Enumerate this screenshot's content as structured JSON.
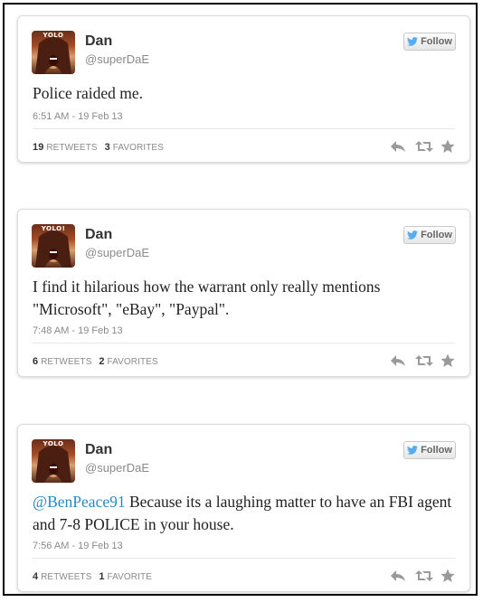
{
  "tweets": [
    {
      "name": "Dan",
      "handle": "@superDaE",
      "follow_label": "Follow",
      "avatar_text": "YOLO",
      "mention": "",
      "text": "Police raided me.",
      "timestamp": "6:51 AM - 19 Feb 13",
      "retweets": "19",
      "retweets_label": "RETWEETS",
      "favorites": "3",
      "favorites_label": "FAVORITES"
    },
    {
      "name": "Dan",
      "handle": "@superDaE",
      "follow_label": "Follow",
      "avatar_text": "YOLO!",
      "mention": "",
      "text": "I find it hilarious how the warrant only really mentions \"Microsoft\", \"eBay\", \"Paypal\".",
      "timestamp": "7:48 AM - 19 Feb 13",
      "retweets": "6",
      "retweets_label": "RETWEETS",
      "favorites": "2",
      "favorites_label": "FAVORITES"
    },
    {
      "name": "Dan",
      "handle": "@superDaE",
      "follow_label": "Follow",
      "avatar_text": "YOLO",
      "mention": "@BenPeace91",
      "text": " Because its a laughing matter to have an FBI agent and 7-8 POLICE in your house.",
      "timestamp": "7:56 AM - 19 Feb 13",
      "retweets": "4",
      "retweets_label": "RETWEETS",
      "favorites": "1",
      "favorites_label": "FAVORITE"
    }
  ],
  "colors": {
    "mention": "#2a8ac0",
    "icon_gray": "#9a9a9a",
    "follow_bird": "#55acee"
  },
  "icons": [
    "twitter-bird-icon",
    "reply-icon",
    "retweet-icon",
    "favorite-star-icon"
  ]
}
